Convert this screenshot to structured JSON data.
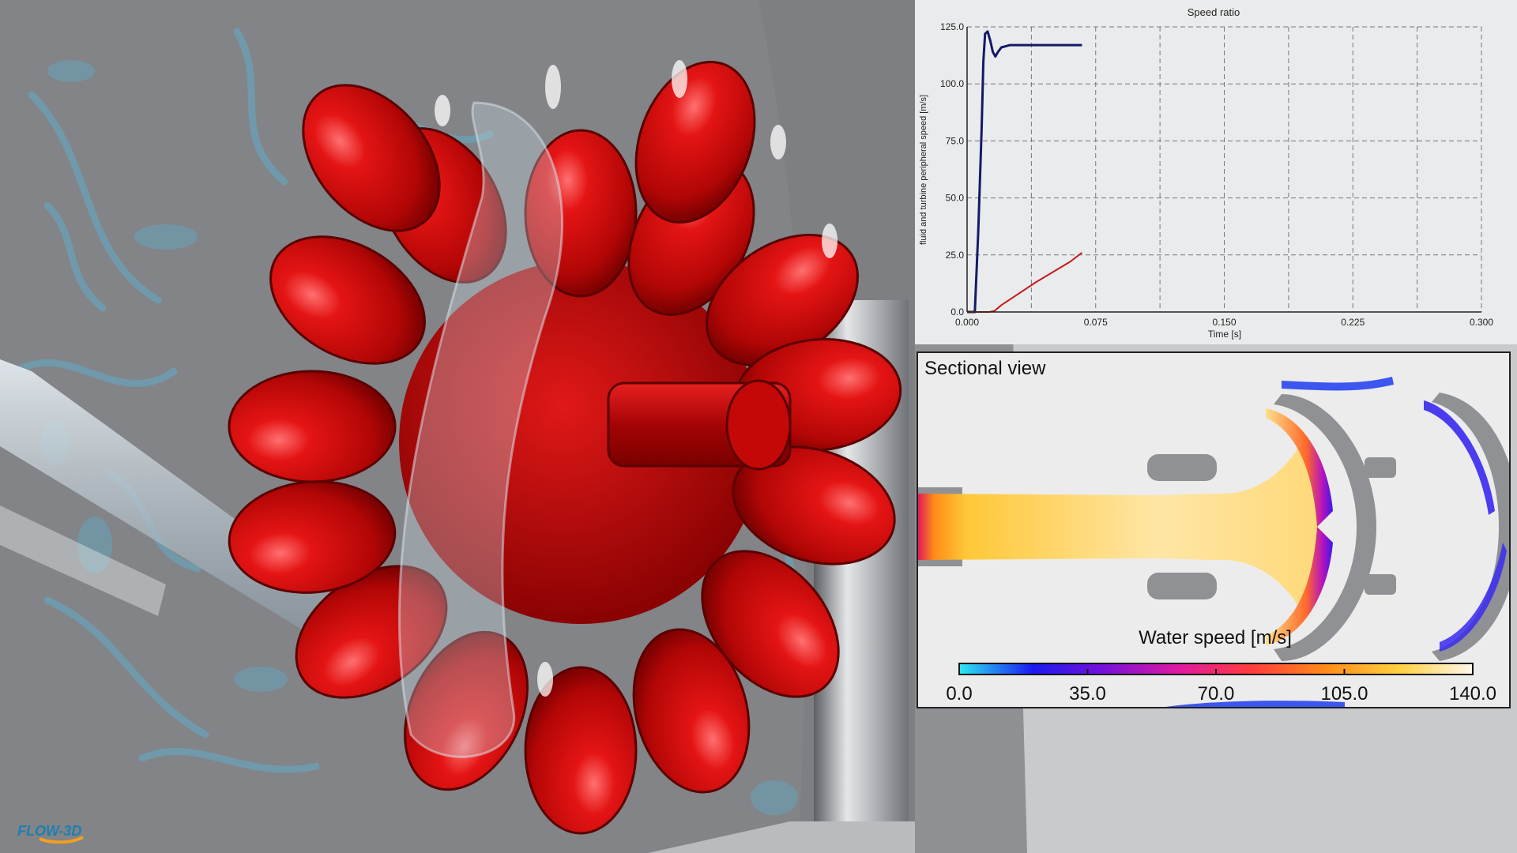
{
  "chart_data": {
    "type": "line",
    "title": "Speed ratio",
    "xlabel": "Time [s]",
    "ylabel": "fluid and turbine peripheral speed [m/s]",
    "xlim": [
      0,
      0.3
    ],
    "ylim": [
      0,
      125
    ],
    "x_ticks": [
      "0.000",
      "0.075",
      "0.150",
      "0.225",
      "0.300"
    ],
    "y_ticks": [
      "0.0",
      "25.0",
      "50.0",
      "75.0",
      "100.0",
      "125.0"
    ],
    "grid": true,
    "series": [
      {
        "color": "#141a66",
        "points": [
          [
            0.0,
            0
          ],
          [
            0.0045,
            0
          ],
          [
            0.0065,
            35
          ],
          [
            0.0085,
            80
          ],
          [
            0.0095,
            110
          ],
          [
            0.0105,
            122
          ],
          [
            0.012,
            123
          ],
          [
            0.0135,
            119
          ],
          [
            0.015,
            114
          ],
          [
            0.0165,
            112
          ],
          [
            0.018,
            114
          ],
          [
            0.02,
            116
          ],
          [
            0.025,
            117
          ],
          [
            0.04,
            117
          ],
          [
            0.067,
            117
          ]
        ]
      },
      {
        "color": "#c41a1a",
        "points": [
          [
            0.0,
            0
          ],
          [
            0.013,
            0
          ],
          [
            0.016,
            0.5
          ],
          [
            0.02,
            3
          ],
          [
            0.03,
            8
          ],
          [
            0.04,
            13
          ],
          [
            0.05,
            17.5
          ],
          [
            0.06,
            22
          ],
          [
            0.067,
            26
          ]
        ]
      }
    ]
  },
  "section_view": {
    "title": "Sectional view",
    "legend_label": "Water speed [m/s]",
    "colorbar_ticks": [
      "0.0",
      "35.0",
      "70.0",
      "105.0",
      "140.0"
    ],
    "colorbar_values": [
      0,
      35,
      70,
      105,
      140
    ],
    "colormap": [
      "#2ee8f0",
      "#1a1af0",
      "#7a10d8",
      "#e01aa0",
      "#ff3c3c",
      "#ff8c18",
      "#ffd040",
      "#fff8ea"
    ]
  },
  "colors": {
    "turbine": "#d40b0b",
    "background_gray": "#7d7f82",
    "water": "#5ab4d8"
  },
  "logo_text": "FLOW-3D"
}
